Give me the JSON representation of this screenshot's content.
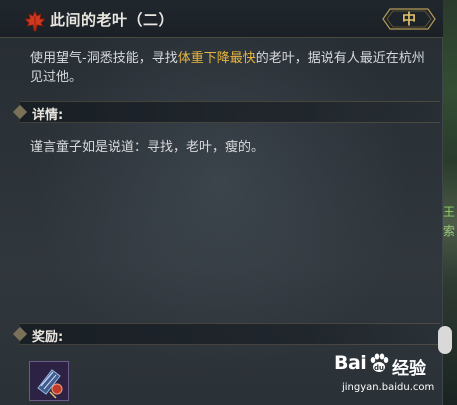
{
  "quest": {
    "title": "此间的老叶（二）",
    "difficulty": "中"
  },
  "description": {
    "before": "使用望气-洞悉技能，寻找",
    "highlight": "体重下降最快",
    "after": "的老叶，据说有人最近在杭州见过他。",
    "highlight_color": "#e8b63e"
  },
  "details": {
    "label": "详情:",
    "text": "谨言童子如是说道：寻找，老叶，瘦的。"
  },
  "rewards": {
    "label": "奖励:",
    "items": [
      {
        "icon": "scroll-item-icon"
      }
    ]
  },
  "watermark": {
    "logo_left": "Bai",
    "logo_right": "经验",
    "url": "jingyan.baidu.com"
  },
  "side_glyphs": [
    "王",
    "索"
  ]
}
